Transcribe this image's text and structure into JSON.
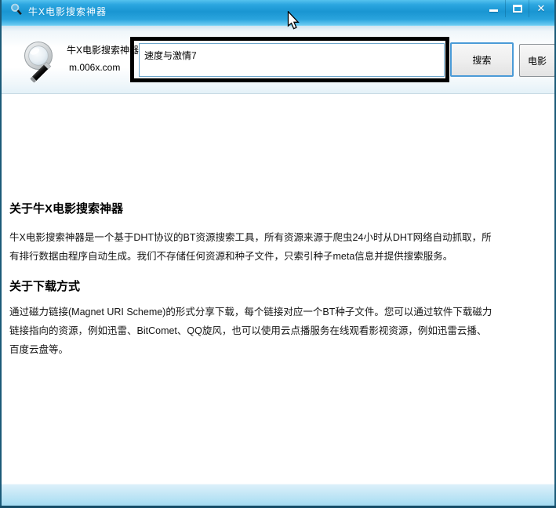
{
  "window": {
    "title": "牛X电影搜索神器",
    "close_glyph": "✕"
  },
  "header": {
    "app_name": "牛X电影搜索神器",
    "app_url": "m.006x.com",
    "search": {
      "value": "速度与激情7",
      "button_label": "搜索"
    },
    "movie_button_label": "电影"
  },
  "content": {
    "about": {
      "heading": "关于牛X电影搜索神器",
      "body": "牛X电影搜索神器是一个基于DHT协议的BT资源搜索工具，所有资源来源于爬虫24小时从DHT网络自动抓取，所\n有排行数据由程序自动生成。我们不存储任何资源和种子文件，只索引种子meta信息并提供搜索服务。"
    },
    "download": {
      "heading": "关于下载方式",
      "body": "通过磁力链接(Magnet URI Scheme)的形式分享下载，每个链接对应一个BT种子文件。您可以通过软件下载磁力\n链接指向的资源，例如迅雷、BitComet、QQ旋风，也可以使用云点播服务在线观看影视资源，例如迅雷云播、\n百度云盘等。"
    }
  },
  "colors": {
    "titlebar_blue": "#1995d2",
    "window_border": "#1b5a78",
    "statusbar_blue": "#a5dcf2",
    "search_button_border": "#4b9bd7",
    "annotation_box": "#000000"
  }
}
